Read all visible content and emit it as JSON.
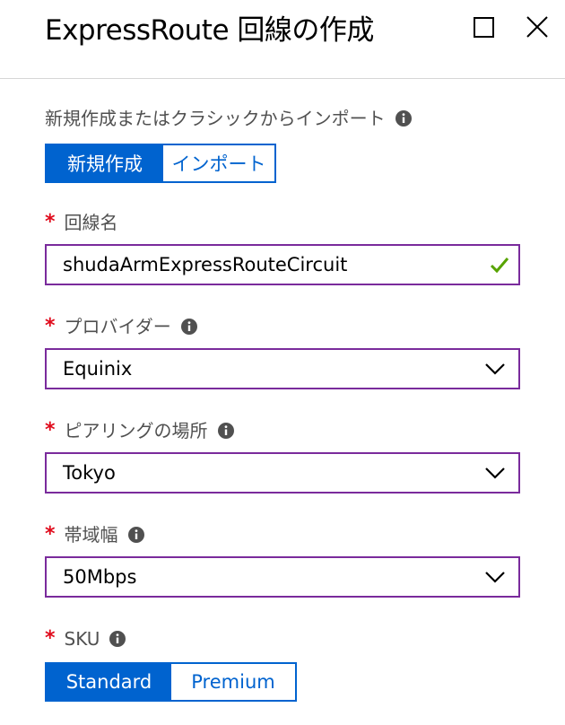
{
  "header": {
    "title": "ExpressRoute 回線の作成"
  },
  "create_mode": {
    "label": "新規作成またはクラシックからインポート",
    "options": [
      "新規作成",
      "インポート"
    ],
    "selected": "新規作成"
  },
  "circuit_name": {
    "label": "回線名",
    "required_mark": "*",
    "value": "shudaArmExpressRouteCircuit"
  },
  "provider": {
    "label": "プロバイダー",
    "required_mark": "*",
    "value": "Equinix"
  },
  "peering_location": {
    "label": "ピアリングの場所",
    "required_mark": "*",
    "value": "Tokyo"
  },
  "bandwidth": {
    "label": "帯域幅",
    "required_mark": "*",
    "value": "50Mbps"
  },
  "sku": {
    "label": "SKU",
    "required_mark": "*",
    "options": [
      "Standard",
      "Premium"
    ],
    "selected": "Standard"
  },
  "colors": {
    "accent": "#0063cf",
    "input_border": "#7a2b9c",
    "required": "#e00b1c",
    "valid_check": "#57a300",
    "label_text": "#505050"
  },
  "icons": {
    "maximize": "maximize-icon",
    "close": "close-icon",
    "info": "info-icon",
    "valid": "check-icon",
    "dropdown": "chevron-down-icon"
  }
}
